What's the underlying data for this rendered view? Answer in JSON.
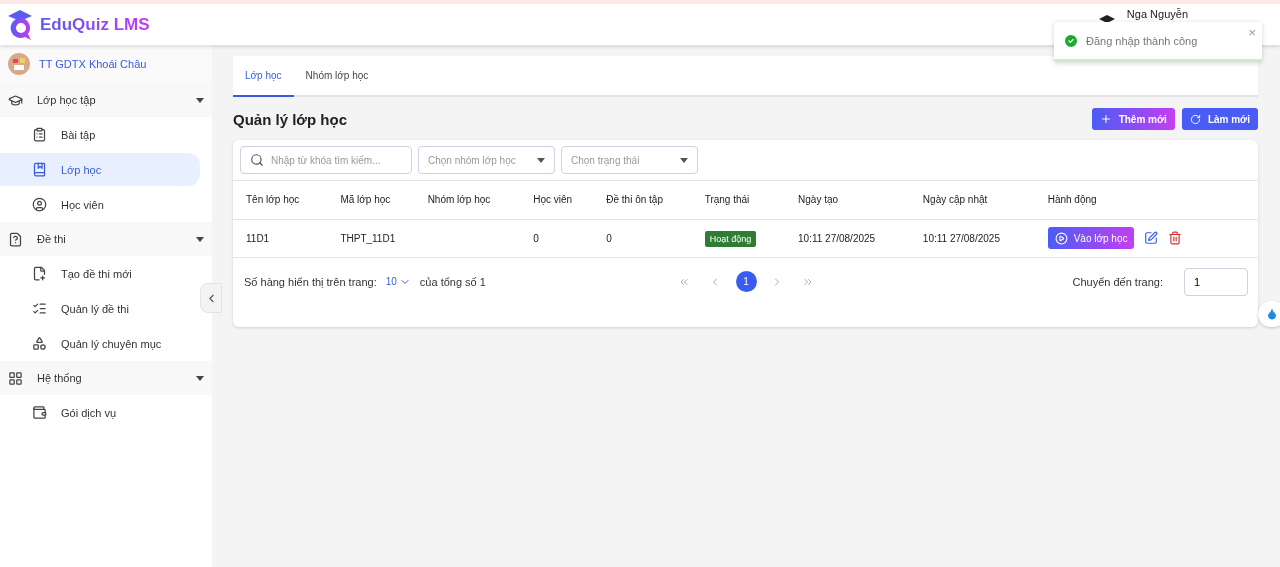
{
  "header": {
    "logo": "EduQuiz LMS",
    "user_name": "Nga Nguyễn"
  },
  "toast": {
    "message": "Đăng nhập thành công",
    "close": "×"
  },
  "sidebar": {
    "organization": "TT GDTX Khoái Châu",
    "groups": [
      {
        "label": "Lớp học tập",
        "expanded": true,
        "children": [
          {
            "label": "Bài tập",
            "selected": false
          },
          {
            "label": "Lớp học",
            "selected": true
          },
          {
            "label": "Học viên",
            "selected": false
          }
        ]
      },
      {
        "label": "Đề thi",
        "expanded": true,
        "children": [
          {
            "label": "Tạo đề thi mới",
            "selected": false
          },
          {
            "label": "Quản lý đề thi",
            "selected": false
          },
          {
            "label": "Quản lý chuyên mục",
            "selected": false
          }
        ]
      },
      {
        "label": "Hệ thống",
        "expanded": true,
        "children": [
          {
            "label": "Gói dịch vụ",
            "selected": false
          }
        ]
      }
    ]
  },
  "tabs": [
    {
      "label": "Lớp học",
      "selected": true
    },
    {
      "label": "Nhóm lớp học",
      "selected": false
    }
  ],
  "page_title": "Quản lý lớp học",
  "actions": [
    {
      "label": "Thêm mới",
      "kind": "add"
    },
    {
      "label": "Làm mới",
      "kind": "refresh"
    }
  ],
  "filters": {
    "search_placeholder": "Nhập từ khóa tìm kiếm...",
    "group_placeholder": "Chọn nhóm lớp học",
    "status_placeholder": "Chọn trạng thái"
  },
  "table": {
    "columns": [
      "Tên lớp học",
      "Mã lớp học",
      "Nhóm lớp học",
      "Học viên",
      "Đề thi ôn tập",
      "Trạng thái",
      "Ngày tạo",
      "Ngày cập nhật",
      "Hành động"
    ],
    "rows": [
      {
        "name": "11D1",
        "code": "THPT_11D1",
        "students": "0",
        "exams": "0",
        "status": "Hoạt động",
        "created": "10:11 27/08/2025",
        "updated": "10:11 27/08/2025",
        "enter": "Vào lớp học"
      }
    ]
  },
  "pagination": {
    "rows_label": "Số hàng hiển thị trên trang:",
    "rows_per_page": "10",
    "total": "của tổng số 1",
    "pages": [
      {
        "label": "1",
        "selected": true
      }
    ],
    "goto_label": "Chuyển đến trang:",
    "goto_value": "1"
  }
}
